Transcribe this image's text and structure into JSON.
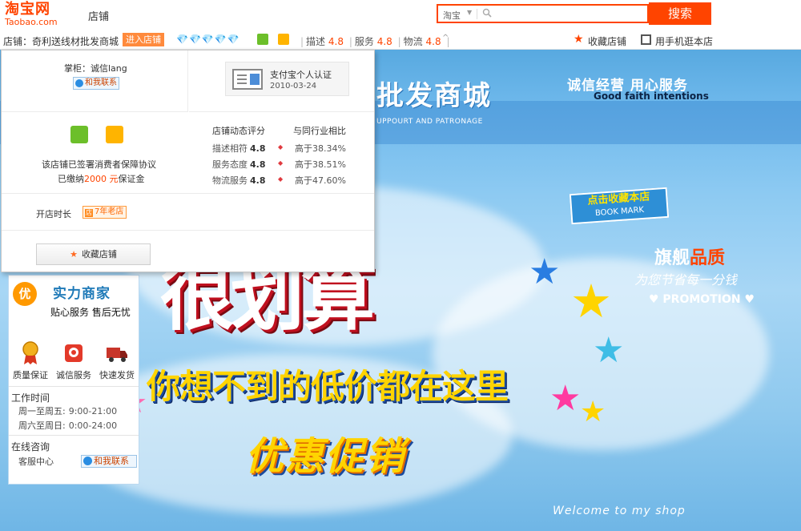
{
  "header": {
    "logo_main": "淘宝网",
    "logo_sub": "Taobao.com",
    "shop_label": "店铺",
    "search_scope": "淘宝",
    "search_placeholder": "",
    "search_button": "搜索"
  },
  "shopbar": {
    "shop_name": "店铺：奇利送线材批发商城",
    "enter_button": "进入店铺",
    "diamonds": "💎💎💎💎💎",
    "scores": [
      {
        "label": "描述",
        "value": "4.8"
      },
      {
        "label": "服务",
        "value": "4.8"
      },
      {
        "label": "物流",
        "value": "4.8"
      }
    ],
    "favorite": "收藏店铺",
    "mobile": "用手机逛本店"
  },
  "popup": {
    "keeper": "掌柜：诚信lang",
    "chat": "和我联系",
    "cert_title": "支付宝个人认证",
    "cert_date": "2010-03-24",
    "protect_line1": "该店铺已签署消费者保障协议",
    "protect_line2_pre": "已缴纳",
    "protect_amount": "2000 元",
    "protect_line2_post": "保证金",
    "rating_header": "店铺动态评分",
    "compare_header": "与同行业相比",
    "ratings": [
      {
        "label": "描述相符",
        "value": "4.8",
        "compare": "高于38.34%"
      },
      {
        "label": "服务态度",
        "value": "4.8",
        "compare": "高于38.51%"
      },
      {
        "label": "物流服务",
        "value": "4.8",
        "compare": "高于47.60%"
      }
    ],
    "open_label": "开店时长",
    "open_years": "7年老店",
    "favorite_button": "收藏店铺"
  },
  "banner": {
    "title": "批发商城",
    "subtitle": "UPPOURT AND PATRONAGE",
    "slogan_cn": "诚信经营  用心服务",
    "slogan_en": "Good faith intentions",
    "bookmark_cn": "点击收藏本店",
    "bookmark_en": "BOOK MARK",
    "flag_white": "旗舰",
    "flag_red": "品质",
    "flag_sub": "为您节省每一分钱",
    "promotion": "♥ PROMOTION ♥",
    "hero_big": "很划算",
    "hero_mid": "你想不到的低价都在这里",
    "hero_low": "优惠促销",
    "welcome": "Welcome to my shop"
  },
  "sidebar": {
    "badge": "优",
    "title": "实力商家",
    "subtitle": "贴心服务  售后无忧",
    "icons": [
      {
        "label": "质量保证",
        "icon": "medal-icon"
      },
      {
        "label": "诚信服务",
        "icon": "handshake-icon"
      },
      {
        "label": "快速发货",
        "icon": "truck-icon"
      }
    ],
    "work_title": "工作时间",
    "work_rows": [
      {
        "days": "周一至周五:",
        "time": "9:00-21:00"
      },
      {
        "days": "周六至周日:",
        "time": "0:00-24:00"
      }
    ],
    "consult_title": "在线咨询",
    "service_label": "客服中心",
    "service_chat": "和我联系"
  }
}
